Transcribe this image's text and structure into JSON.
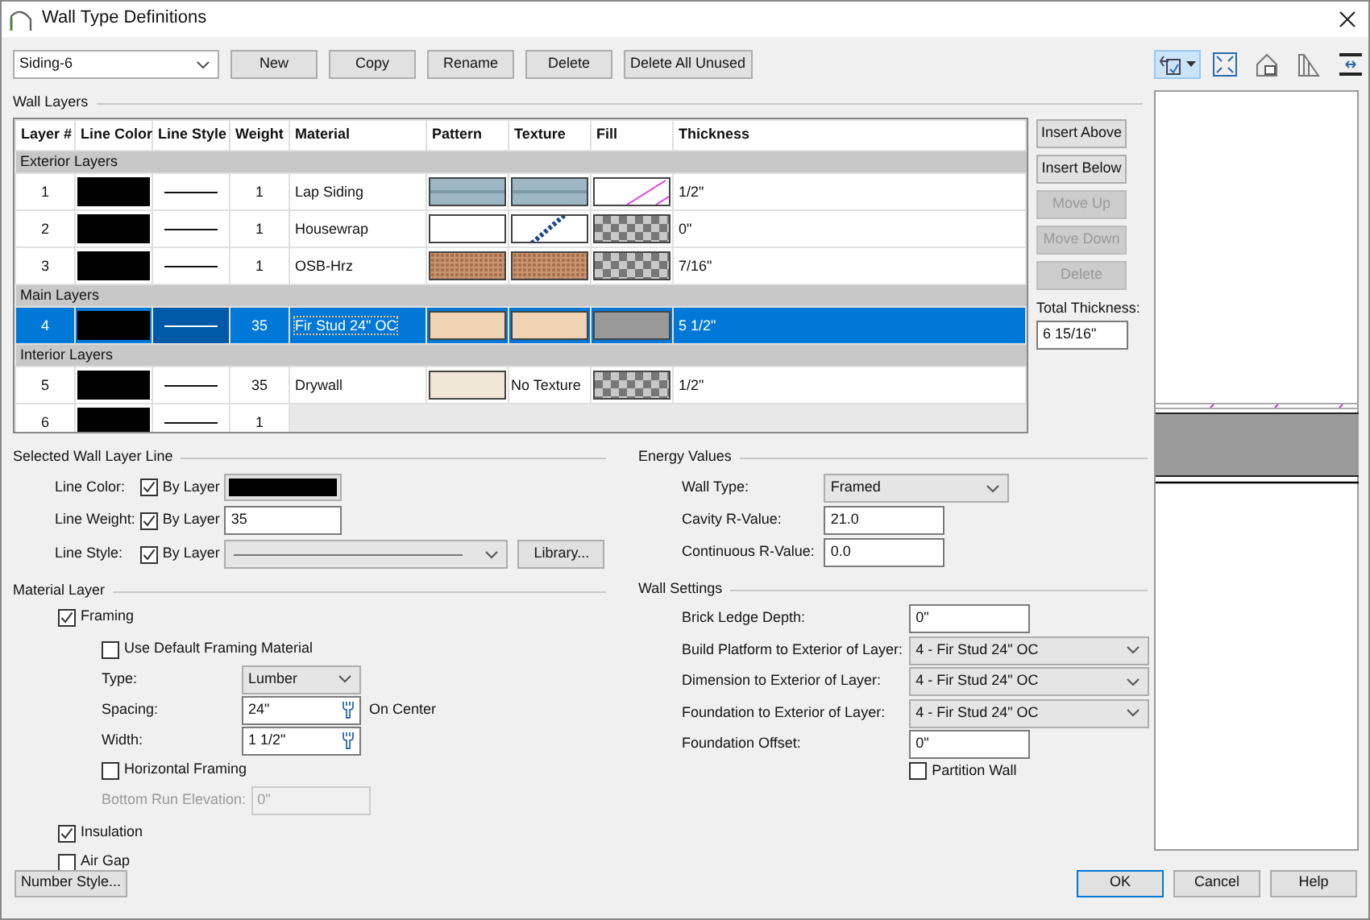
{
  "window": {
    "title": "Wall Type Definitions"
  },
  "wall_type": {
    "value": "Siding-6"
  },
  "top_buttons": [
    "New",
    "Copy",
    "Rename",
    "Delete",
    "Delete All Unused"
  ],
  "preview_toolbar": [
    {
      "selected": true,
      "has_menu": true
    },
    {
      "selected": false,
      "has_menu": false
    },
    {
      "selected": false,
      "has_menu": false
    },
    {
      "selected": false,
      "has_menu": false
    },
    {
      "selected": false,
      "has_menu": false
    }
  ],
  "wall_layers": {
    "title": "Wall Layers",
    "columns": [
      "Layer #",
      "Line Color",
      "Line Style",
      "Weight",
      "Material",
      "Pattern",
      "Texture",
      "Fill",
      "Thickness"
    ],
    "rows": [
      {
        "kind": "group",
        "label": "Exterior Layers"
      },
      {
        "kind": "layer",
        "selected": false,
        "layer": "1",
        "weight": "1",
        "material": "Lap Siding",
        "pattern": {
          "kind": "siding"
        },
        "texture": {
          "kind": "siding"
        },
        "fill": {
          "kind": "diagonal"
        },
        "thickness": "1/2\""
      },
      {
        "kind": "layer",
        "selected": false,
        "layer": "2",
        "weight": "1",
        "material": "Housewrap",
        "pattern": {
          "kind": "white"
        },
        "texture": {
          "kind": "wrap"
        },
        "fill": {
          "kind": "checker"
        },
        "thickness": "0\""
      },
      {
        "kind": "layer",
        "selected": false,
        "layer": "3",
        "weight": "1",
        "material": "OSB-Hrz",
        "pattern": {
          "kind": "osb"
        },
        "texture": {
          "kind": "osb"
        },
        "fill": {
          "kind": "checker"
        },
        "thickness": "7/16\""
      },
      {
        "kind": "group",
        "label": "Main Layers"
      },
      {
        "kind": "layer",
        "selected": true,
        "layer": "4",
        "weight": "35",
        "material": "Fir Stud 24\" OC",
        "pattern": {
          "kind": "wood"
        },
        "texture": {
          "kind": "wood"
        },
        "fill": {
          "kind": "grey"
        },
        "thickness": "5 1/2\""
      },
      {
        "kind": "group",
        "label": "Interior Layers"
      },
      {
        "kind": "layer",
        "selected": false,
        "layer": "5",
        "weight": "35",
        "material": "Drywall",
        "pattern": {
          "kind": "cream"
        },
        "texture": {
          "kind": "text",
          "label": "No Texture"
        },
        "fill": {
          "kind": "checker"
        },
        "thickness": "1/2\""
      },
      {
        "kind": "layer",
        "selected": false,
        "layer": "6",
        "weight": "1"
      }
    ]
  },
  "layer_buttons": [
    {
      "label": "Insert Above",
      "disabled": false
    },
    {
      "label": "Insert Below",
      "disabled": false
    },
    {
      "label": "Move Up",
      "disabled": true
    },
    {
      "label": "Move Down",
      "disabled": true
    },
    {
      "label": "Delete",
      "disabled": true
    }
  ],
  "total_thickness": {
    "label": "Total Thickness:",
    "value": "6 15/16\""
  },
  "selected_line": {
    "title": "Selected Wall Layer Line",
    "rows": [
      {
        "kind": "color",
        "label": "Line Color:",
        "by_layer_label": "By Layer",
        "by_layer": true
      },
      {
        "kind": "number",
        "label": "Line Weight:",
        "by_layer_label": "By Layer",
        "by_layer": true,
        "value": "35"
      },
      {
        "kind": "style",
        "label": "Line Style:",
        "by_layer_label": "By Layer",
        "by_layer": true,
        "button": "Library..."
      }
    ]
  },
  "energy": {
    "title": "Energy Values",
    "fields": [
      {
        "kind": "select",
        "label": "Wall Type:",
        "value": "Framed"
      },
      {
        "kind": "input",
        "label": "Cavity R-Value:",
        "value": "21.0"
      },
      {
        "kind": "input",
        "label": "Continuous R-Value:",
        "value": "0.0"
      }
    ]
  },
  "material_layer": {
    "title": "Material Layer",
    "items": [
      {
        "kind": "checkbox",
        "label": "Framing",
        "checked": true,
        "children": [
          {
            "kind": "checkbox",
            "label": "Use Default Framing Material",
            "checked": false,
            "disabled": false
          },
          {
            "kind": "select",
            "label": "Type:",
            "value": "Lumber",
            "disabled": false
          },
          {
            "kind": "spin",
            "label": "Spacing:",
            "value": "24\"",
            "suffix": "On Center",
            "disabled": false
          },
          {
            "kind": "spin",
            "label": "Width:",
            "value": "1 1/2\"",
            "disabled": false
          },
          {
            "kind": "checkbox",
            "label": "Horizontal Framing",
            "checked": false,
            "disabled": false
          },
          {
            "kind": "input",
            "label": "Bottom Run Elevation:",
            "value": "0\"",
            "disabled": true
          }
        ]
      },
      {
        "kind": "checkbox",
        "label": "Insulation",
        "checked": true
      },
      {
        "kind": "checkbox",
        "label": "Air Gap",
        "checked": false
      }
    ]
  },
  "wall_settings": {
    "title": "Wall Settings",
    "fields": [
      {
        "kind": "input",
        "label": "Brick Ledge Depth:",
        "value": "0\""
      },
      {
        "kind": "select",
        "label": "Build Platform to Exterior of Layer:",
        "value": "4 - Fir Stud 24\" OC"
      },
      {
        "kind": "select",
        "label": "Dimension to Exterior of Layer:",
        "value": "4 - Fir Stud 24\" OC"
      },
      {
        "kind": "select",
        "label": "Foundation to Exterior of Layer:",
        "value": "4 - Fir Stud 24\" OC"
      },
      {
        "kind": "input",
        "label": "Foundation Offset:",
        "value": "0\""
      },
      {
        "kind": "checkbox",
        "label": "Partition Wall",
        "checked": false
      }
    ]
  },
  "footer": {
    "left_button": "Number Style...",
    "buttons": [
      {
        "label": "OK",
        "default": true
      },
      {
        "label": "Cancel",
        "default": false
      },
      {
        "label": "Help",
        "default": false
      }
    ]
  }
}
